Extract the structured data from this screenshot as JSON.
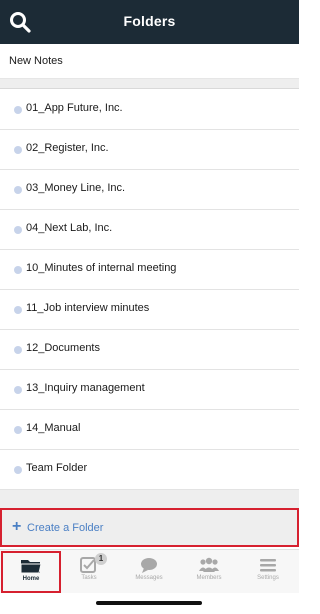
{
  "header": {
    "title": "Folders",
    "search_icon": "search-icon"
  },
  "new_notes": {
    "label": "New Notes"
  },
  "folders": [
    {
      "label": "01_App Future, Inc."
    },
    {
      "label": "02_Register, Inc."
    },
    {
      "label": "03_Money Line, Inc."
    },
    {
      "label": "04_Next Lab, Inc."
    },
    {
      "label": "10_Minutes of internal meeting"
    },
    {
      "label": "11_Job interview minutes"
    },
    {
      "label": "12_Documents"
    },
    {
      "label": "13_Inquiry management"
    },
    {
      "label": "14_Manual"
    },
    {
      "label": "Team Folder"
    }
  ],
  "create_folder": {
    "label": "Create a Folder",
    "color": "#4a7fc4"
  },
  "tabbar": {
    "tabs": [
      {
        "label": "Home",
        "icon": "folder-icon",
        "active": true
      },
      {
        "label": "Tasks",
        "icon": "checkbox-icon",
        "badge": "1"
      },
      {
        "label": "Messages",
        "icon": "chat-bubble-icon"
      },
      {
        "label": "Members",
        "icon": "people-icon"
      },
      {
        "label": "Settings",
        "icon": "menu-icon"
      }
    ]
  },
  "colors": {
    "header_bg": "#1c2b36",
    "highlight": "#d6202f",
    "dot": "#c7d3ea"
  }
}
